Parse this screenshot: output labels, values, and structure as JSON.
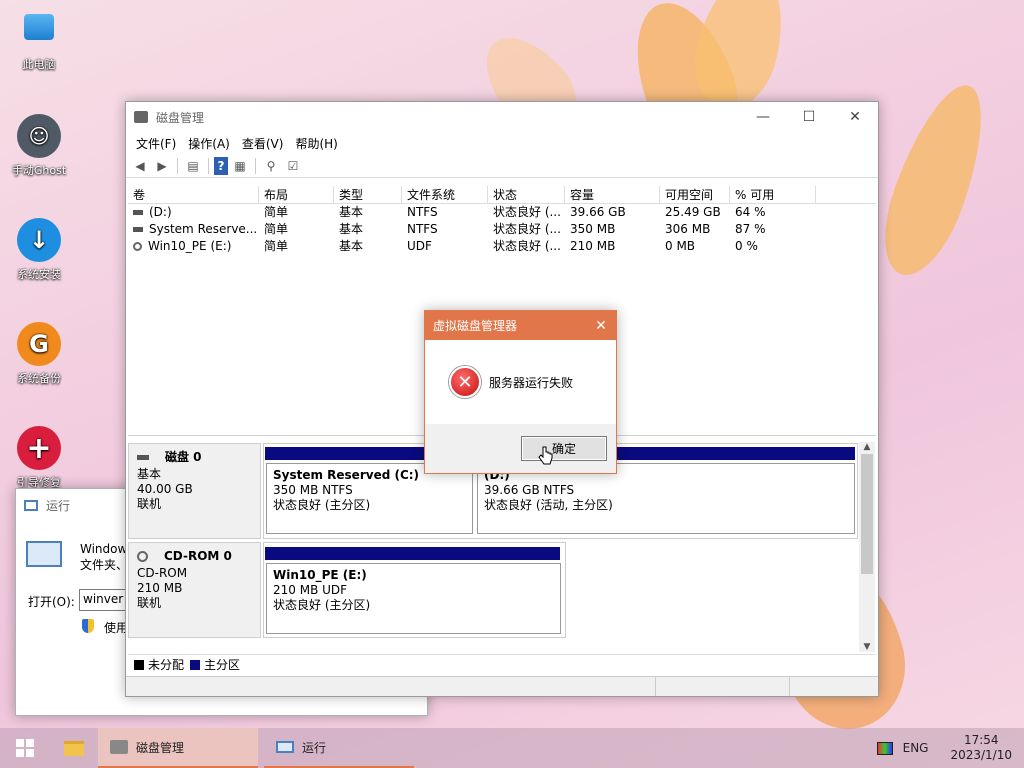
{
  "desktop": {
    "icons": [
      {
        "label": "此电脑",
        "icon": "computer-icon"
      },
      {
        "label": "手动Ghost",
        "icon": "ghost-icon"
      },
      {
        "label": "系统安装",
        "icon": "install-icon"
      },
      {
        "label": "系统备份",
        "icon": "backup-icon"
      },
      {
        "label": "引导修复",
        "icon": "repair-icon"
      }
    ]
  },
  "disk_mgmt": {
    "title": "磁盘管理",
    "menu": [
      "文件(F)",
      "操作(A)",
      "查看(V)",
      "帮助(H)"
    ],
    "columns": [
      "卷",
      "布局",
      "类型",
      "文件系统",
      "状态",
      "容量",
      "可用空间",
      "% 可用"
    ],
    "volumes": [
      {
        "name": "(D:)",
        "layout": "简单",
        "type": "基本",
        "fs": "NTFS",
        "status": "状态良好 (...",
        "capacity": "39.66 GB",
        "free": "25.49 GB",
        "pct": "64 %"
      },
      {
        "name": "System Reserve...",
        "layout": "简单",
        "type": "基本",
        "fs": "NTFS",
        "status": "状态良好 (...",
        "capacity": "350 MB",
        "free": "306 MB",
        "pct": "87 %"
      },
      {
        "name": "Win10_PE (E:)",
        "layout": "简单",
        "type": "基本",
        "fs": "UDF",
        "status": "状态良好 (...",
        "capacity": "210 MB",
        "free": "0 MB",
        "pct": "0 %"
      }
    ],
    "disk0": {
      "name": "磁盘 0",
      "type": "基本",
      "size": "40.00 GB",
      "state": "联机"
    },
    "cdrom0": {
      "name": "CD-ROM 0",
      "type": "CD-ROM",
      "size": "210 MB",
      "state": "联机"
    },
    "partitions": [
      {
        "title": "System Reserved  (C:)",
        "size": "350 MB NTFS",
        "status": "状态良好 (主分区)"
      },
      {
        "title": "(D:)",
        "size": "39.66 GB NTFS",
        "status": "状态良好 (活动, 主分区)"
      },
      {
        "title": "Win10_PE   (E:)",
        "size": "210 MB UDF",
        "status": "状态良好 (主分区)"
      }
    ],
    "legend": {
      "unallocated": "未分配",
      "primary": "主分区",
      "unallocated_color": "#000000",
      "primary_color": "#0a0a80"
    }
  },
  "dialog": {
    "title": "虚拟磁盘管理器",
    "message": "服务器运行失败",
    "ok": "确定",
    "accent": "#e0764a"
  },
  "run": {
    "title": "运行",
    "desc_line1": "Window",
    "desc_line2": "文件夹、",
    "open_label": "打开(O):",
    "open_value": "winver",
    "admin_text": "使用"
  },
  "taskbar": {
    "items": [
      {
        "label": "磁盘管理",
        "icon": "disk-management-icon"
      },
      {
        "label": "运行",
        "icon": "run-icon"
      }
    ],
    "lang": "ENG",
    "time": "17:54",
    "date": "2023/1/10"
  }
}
